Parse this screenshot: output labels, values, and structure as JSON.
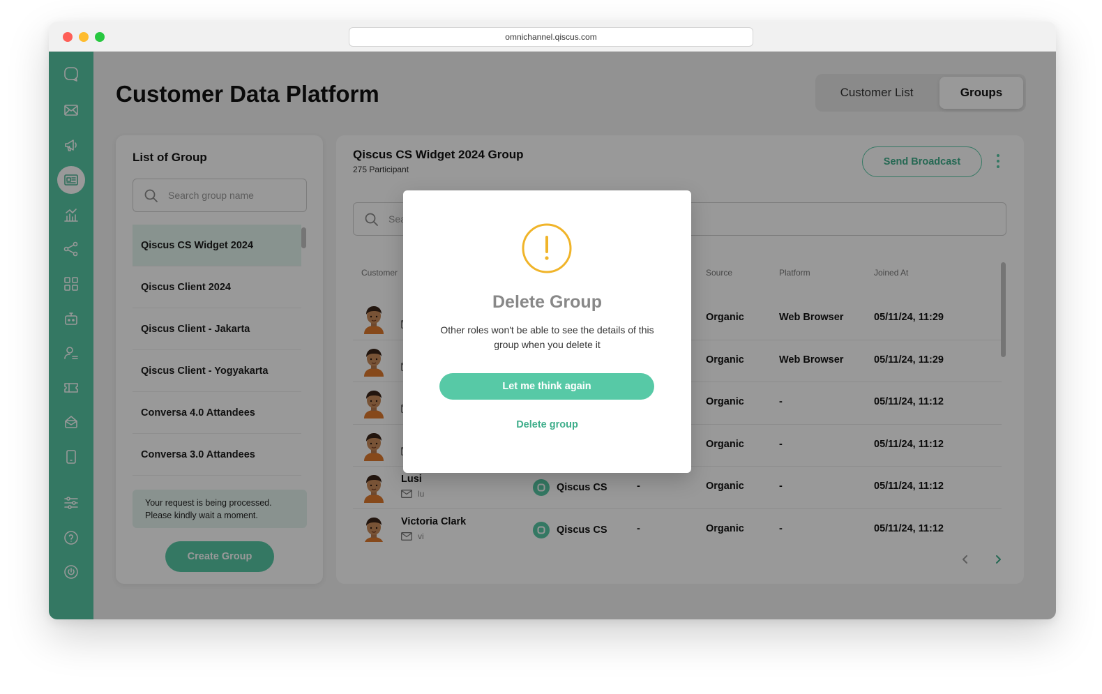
{
  "browser": {
    "url": "omnichannel.qiscus.com"
  },
  "colors": {
    "brand": "#57c9a6",
    "warning": "#f0b429",
    "overlay": "rgba(0,0,0,0.40)"
  },
  "sidebar": {
    "items": [
      {
        "icon": "qiscus-logo-icon"
      },
      {
        "icon": "inbox-icon"
      },
      {
        "icon": "megaphone-icon"
      },
      {
        "icon": "contact-card-icon",
        "active": true
      },
      {
        "icon": "analytics-icon"
      },
      {
        "icon": "share-icon"
      },
      {
        "icon": "apps-grid-icon"
      },
      {
        "icon": "bot-icon"
      },
      {
        "icon": "agent-icon"
      },
      {
        "icon": "ticket-icon"
      },
      {
        "icon": "mailbox-icon"
      },
      {
        "icon": "mobile-icon"
      },
      {
        "icon": "settings-sliders-icon"
      },
      {
        "icon": "help-icon"
      },
      {
        "icon": "power-icon"
      }
    ]
  },
  "header": {
    "title": "Customer Data Platform",
    "tabs": [
      "Customer List",
      "Groups"
    ],
    "active_tab": "Groups"
  },
  "group_panel": {
    "title": "List of Group",
    "search_placeholder": "Search group name",
    "groups": [
      "Qiscus CS Widget 2024",
      "Qiscus Client 2024",
      "Qiscus Client - Jakarta",
      "Qiscus Client - Yogyakarta",
      "Conversa 4.0 Attandees",
      "Conversa 3.0 Attandees"
    ],
    "selected_group": "Qiscus CS Widget 2024",
    "toast": "Your request is being processed. Please kindly wait a moment.",
    "create_button": "Create Group"
  },
  "detail_panel": {
    "title": "Qiscus CS Widget 2024 Group",
    "participants": "275 Participant",
    "send_broadcast": "Send Broadcast",
    "search_placeholder": "Sea",
    "columns": {
      "customer": "Customer",
      "source": "Source",
      "platform": "Platform",
      "joined": "Joined At"
    },
    "rows": [
      {
        "name": "",
        "email": "",
        "channel": "",
        "extra": "",
        "source": "Organic",
        "platform": "Web Browser",
        "joined": "05/11/24, 11:29"
      },
      {
        "name": "",
        "email": "",
        "channel": "",
        "extra": "",
        "source": "Organic",
        "platform": "Web Browser",
        "joined": "05/11/24, 11:29"
      },
      {
        "name": "",
        "email": "",
        "channel": "",
        "extra": "",
        "source": "Organic",
        "platform": "-",
        "joined": "05/11/24, 11:12"
      },
      {
        "name": "",
        "email": "",
        "channel": "",
        "extra": "",
        "source": "Organic",
        "platform": "-",
        "joined": "05/11/24, 11:12"
      },
      {
        "name": "Lusi",
        "email": "lu",
        "channel": "Qiscus CS",
        "extra": "-",
        "source": "Organic",
        "platform": "-",
        "joined": "05/11/24, 11:12"
      },
      {
        "name": "Victoria Clark",
        "email": "vi",
        "channel": "Qiscus CS",
        "extra": "-",
        "source": "Organic",
        "platform": "-",
        "joined": "05/11/24, 11:12"
      }
    ]
  },
  "modal": {
    "icon": "warning-icon",
    "title": "Delete Group",
    "description": "Other roles won't be able to see the details of this group when you delete it",
    "confirm_button": "Let me think again",
    "delete_button": "Delete group"
  }
}
